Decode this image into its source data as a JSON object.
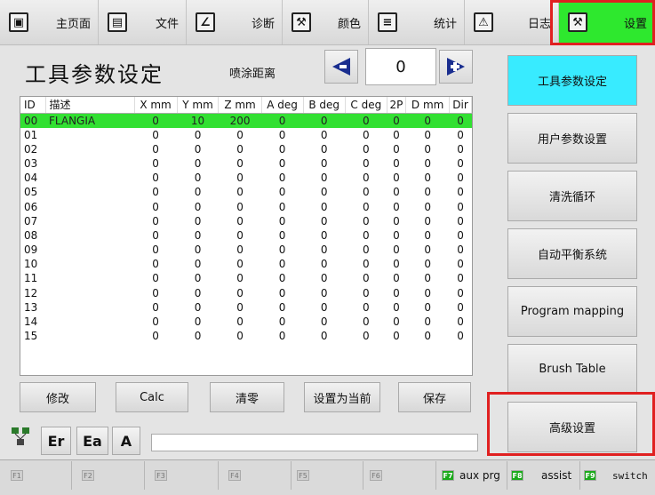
{
  "nav": {
    "items": [
      {
        "icon": "monitor-icon",
        "label": "主页面",
        "glyph": "▣"
      },
      {
        "icon": "document-icon",
        "label": "文件",
        "glyph": "▤"
      },
      {
        "icon": "diagnose-icon",
        "label": "诊断",
        "glyph": "∠"
      },
      {
        "icon": "wrench-icon",
        "label": "颜色",
        "glyph": "⚒"
      },
      {
        "icon": "stats-icon",
        "label": "统计",
        "glyph": "≡"
      },
      {
        "icon": "warning-icon",
        "label": "日志",
        "glyph": "⚠"
      },
      {
        "icon": "settings-wrench-icon",
        "label": "设置",
        "glyph": "⚒"
      }
    ],
    "active": "设置",
    "active_color": "#2ee82e"
  },
  "header": {
    "title": "工具参数设定",
    "spray_label": "喷涂距离",
    "counter_value": "0",
    "prev_icon": "arrow-left-icon",
    "next_icon": "arrow-right-icon"
  },
  "table": {
    "columns": [
      "ID",
      "描述",
      "X mm",
      "Y mm",
      "Z mm",
      "A deg",
      "B deg",
      "C deg",
      "2P",
      "D mm",
      "Dir"
    ],
    "rows": [
      [
        "00",
        "FLANGIA",
        "0",
        "10",
        "200",
        "0",
        "0",
        "0",
        "0",
        "0",
        "0"
      ],
      [
        "01",
        "",
        "0",
        "0",
        "0",
        "0",
        "0",
        "0",
        "0",
        "0",
        "0"
      ],
      [
        "02",
        "",
        "0",
        "0",
        "0",
        "0",
        "0",
        "0",
        "0",
        "0",
        "0"
      ],
      [
        "03",
        "",
        "0",
        "0",
        "0",
        "0",
        "0",
        "0",
        "0",
        "0",
        "0"
      ],
      [
        "04",
        "",
        "0",
        "0",
        "0",
        "0",
        "0",
        "0",
        "0",
        "0",
        "0"
      ],
      [
        "05",
        "",
        "0",
        "0",
        "0",
        "0",
        "0",
        "0",
        "0",
        "0",
        "0"
      ],
      [
        "06",
        "",
        "0",
        "0",
        "0",
        "0",
        "0",
        "0",
        "0",
        "0",
        "0"
      ],
      [
        "07",
        "",
        "0",
        "0",
        "0",
        "0",
        "0",
        "0",
        "0",
        "0",
        "0"
      ],
      [
        "08",
        "",
        "0",
        "0",
        "0",
        "0",
        "0",
        "0",
        "0",
        "0",
        "0"
      ],
      [
        "09",
        "",
        "0",
        "0",
        "0",
        "0",
        "0",
        "0",
        "0",
        "0",
        "0"
      ],
      [
        "10",
        "",
        "0",
        "0",
        "0",
        "0",
        "0",
        "0",
        "0",
        "0",
        "0"
      ],
      [
        "11",
        "",
        "0",
        "0",
        "0",
        "0",
        "0",
        "0",
        "0",
        "0",
        "0"
      ],
      [
        "12",
        "",
        "0",
        "0",
        "0",
        "0",
        "0",
        "0",
        "0",
        "0",
        "0"
      ],
      [
        "13",
        "",
        "0",
        "0",
        "0",
        "0",
        "0",
        "0",
        "0",
        "0",
        "0"
      ],
      [
        "14",
        "",
        "0",
        "0",
        "0",
        "0",
        "0",
        "0",
        "0",
        "0",
        "0"
      ],
      [
        "15",
        "",
        "0",
        "0",
        "0",
        "0",
        "0",
        "0",
        "0",
        "0",
        "0"
      ]
    ],
    "selected_row": "00",
    "selected_color": "#32e032"
  },
  "actions": {
    "modify": "修改",
    "calc": "Calc",
    "clear": "清零",
    "set_current": "设置为当前",
    "save": "保存"
  },
  "side_menu": {
    "items": [
      "工具参数设定",
      "用户参数设置",
      "清洗循环",
      "自动平衡系统",
      "Program mapping",
      "Brush Table",
      "高级设置"
    ],
    "active": "工具参数设定",
    "active_color": "#38ebff"
  },
  "toolbar": {
    "network_icon": "network-icon",
    "er": "Er",
    "ea": "Ea",
    "a": "A",
    "command_value": ""
  },
  "fkeys": [
    {
      "key": "F1",
      "label": ""
    },
    {
      "key": "F2",
      "label": ""
    },
    {
      "key": "F3",
      "label": ""
    },
    {
      "key": "F4",
      "label": ""
    },
    {
      "key": "F5",
      "label": ""
    },
    {
      "key": "F6",
      "label": ""
    },
    {
      "key": "F7",
      "label": "aux prg"
    },
    {
      "key": "F8",
      "label": "assist"
    },
    {
      "key": "F9",
      "label": "switch"
    }
  ],
  "highlight_color": "#e02020"
}
